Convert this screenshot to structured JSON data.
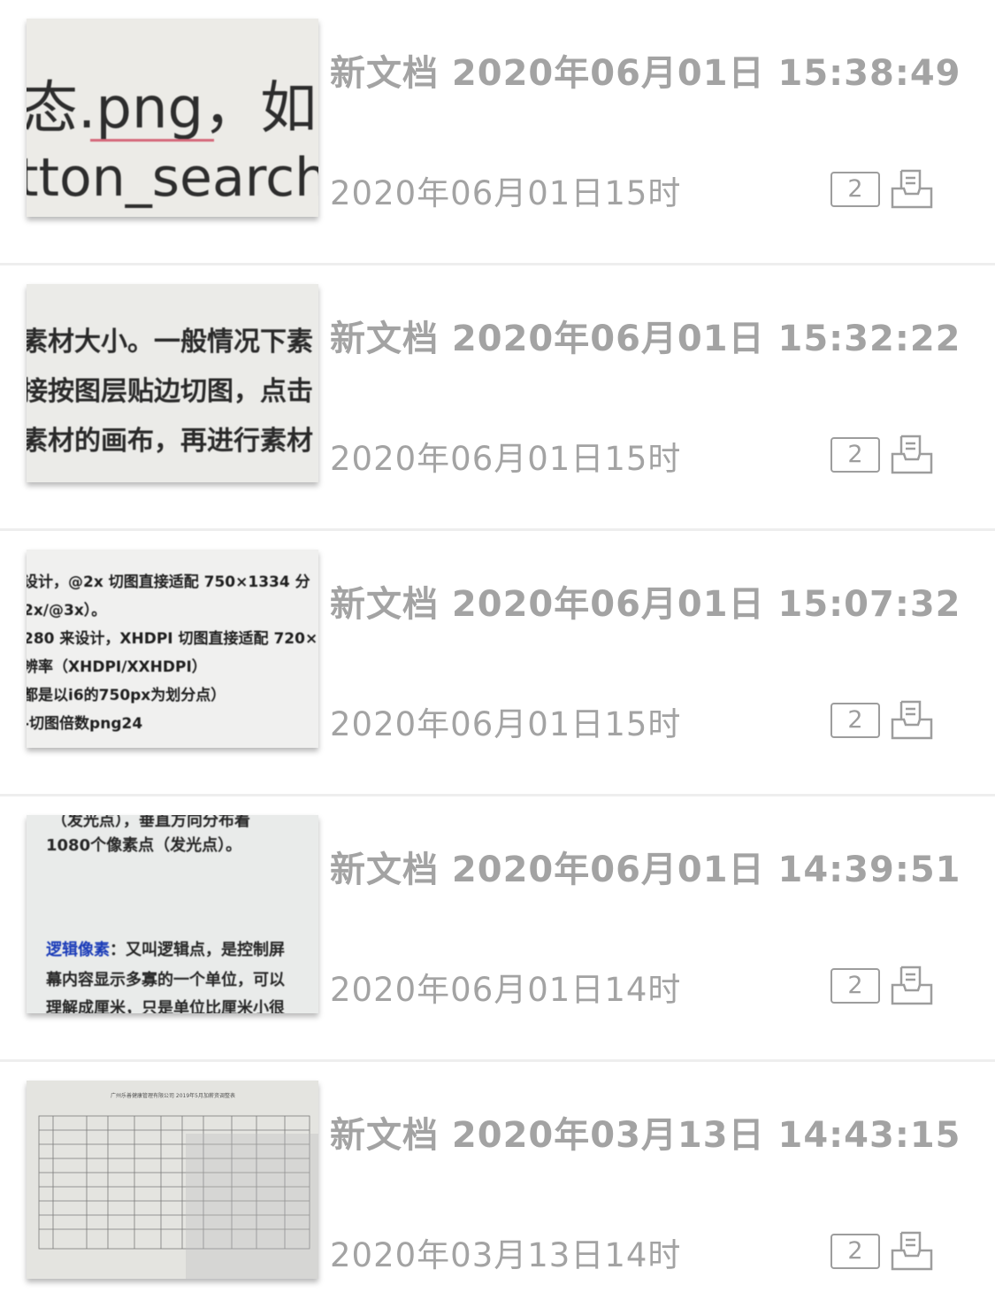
{
  "documents": [
    {
      "title": "新文档 2020年06月01日 15:38:49",
      "date": "2020年06月01日15时",
      "page_count": "2",
      "thumb_lines": [
        "态.png，如：",
        "tton_search_"
      ]
    },
    {
      "title": "新文档 2020年06月01日 15:32:22",
      "date": "2020年06月01日15时",
      "page_count": "2",
      "thumb_lines": [
        "素材大小。一般情况下素",
        "接按图层贴边切图，点击",
        "素材的画布，再进行素材"
      ]
    },
    {
      "title": "新文档 2020年06月01日 15:07:32",
      "date": "2020年06月01日15时",
      "page_count": "2",
      "thumb_lines": [
        "设计，@2x 切图直接适配 750×1334 分",
        "2x/@3x）。",
        "280 来设计，XHDPI 切图直接适配 720×",
        "辨率（XHDPI/XXHDPI）",
        "都是以i6的750px为划分点）",
        "-切图倍数png24"
      ]
    },
    {
      "title": "新文档 2020年06月01日 14:39:51",
      "date": "2020年06月01日14时",
      "page_count": "2",
      "thumb_lines": [
        "（发光点），垂直方向分布着",
        "1080个像素点（发光点）。",
        "逻辑像素",
        "：又叫逻辑点，是控制屏",
        "幕内容显示多寡的一个单位，可以",
        "理解成厘米，只是单位比厘米小很"
      ]
    },
    {
      "title": "新文档 2020年03月13日 14:43:15",
      "date": "2020年03月13日14时",
      "page_count": "2",
      "thumb_lines": [
        "广州乐善健康管理有限公司 2019年5月加薪资调整表"
      ]
    }
  ],
  "icons": {
    "page_count": "page-count-badge",
    "action": "tray-export-icon"
  },
  "colors": {
    "text_gray": "#a3a3a3",
    "divider": "#eeeeee",
    "thumb_link_blue": "#1a3bb8"
  }
}
